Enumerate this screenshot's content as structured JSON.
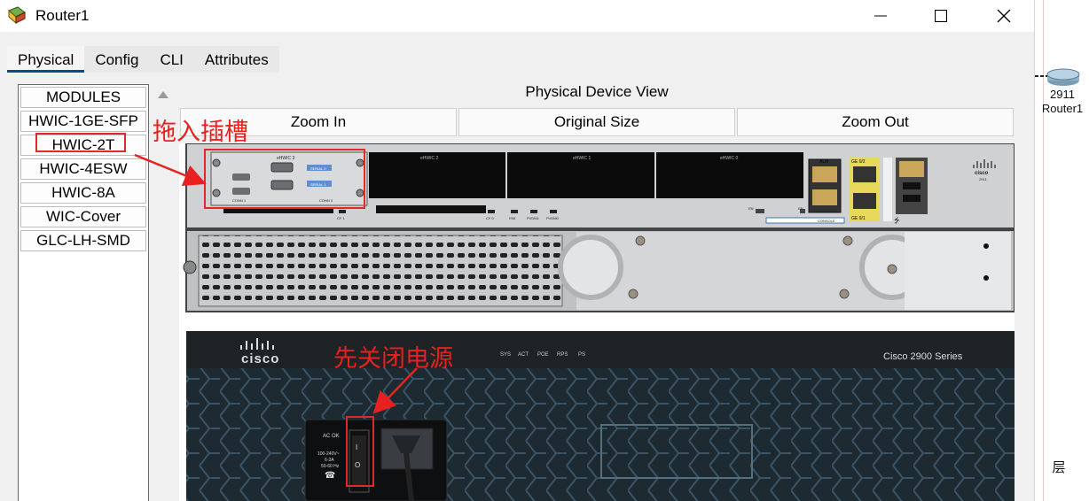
{
  "window": {
    "title": "Router1"
  },
  "tabs": [
    {
      "label": "Physical",
      "active": true
    },
    {
      "label": "Config",
      "active": false
    },
    {
      "label": "CLI",
      "active": false
    },
    {
      "label": "Attributes",
      "active": false
    }
  ],
  "modules": [
    "MODULES",
    "HWIC-1GE-SFP",
    "HWIC-2T",
    "HWIC-4ESW",
    "HWIC-8A",
    "WIC-Cover",
    "GLC-LH-SMD"
  ],
  "device_view": {
    "title": "Physical Device View",
    "zoom_in": "Zoom In",
    "original_size": "Original Size",
    "zoom_out": "Zoom Out"
  },
  "chassis": {
    "slots": [
      "eHWIC 3",
      "eHWIC 2",
      "eHWIC 1",
      "eHWIC 0"
    ],
    "hwic_port_labels": [
      "SERIAL 0",
      "SERIAL 1"
    ],
    "hwic_conn_labels": [
      "CONN 1",
      "CONN 0"
    ],
    "cf_labels": [
      "CF 1",
      "CF 0"
    ],
    "leds": [
      "ISM",
      "PVDM1",
      "PVDM0"
    ],
    "aux": "AUX",
    "console": "CONSOLE",
    "ge_labels": [
      "GE 0/2",
      "GE 0/1"
    ],
    "ge0": "GE 0/0",
    "en": "EN",
    "usb_symbol": "⭍",
    "brand": "cisco",
    "model": "2911",
    "front_leds": [
      "SYS",
      "ACT",
      "POE",
      "RPS",
      "PS"
    ],
    "series": "Cisco 2900 Series",
    "psu_ac_ok": "AC OK",
    "psu_rating": [
      "100-240V~",
      "6-2A",
      "50-60 Hz"
    ],
    "switch_on": "I",
    "switch_off": "O"
  },
  "annotations": {
    "drag_into_slot": "拖入插槽",
    "power_off_first": "先关闭电源"
  },
  "background": {
    "device_name": "Router1",
    "device_model": "2911",
    "side_char": "层"
  },
  "colors": {
    "annotation_red": "#e82020",
    "tab_underline": "#0a4a8a",
    "chassis_gray": "#cfd1d3",
    "front_panel": "#1f2326"
  }
}
